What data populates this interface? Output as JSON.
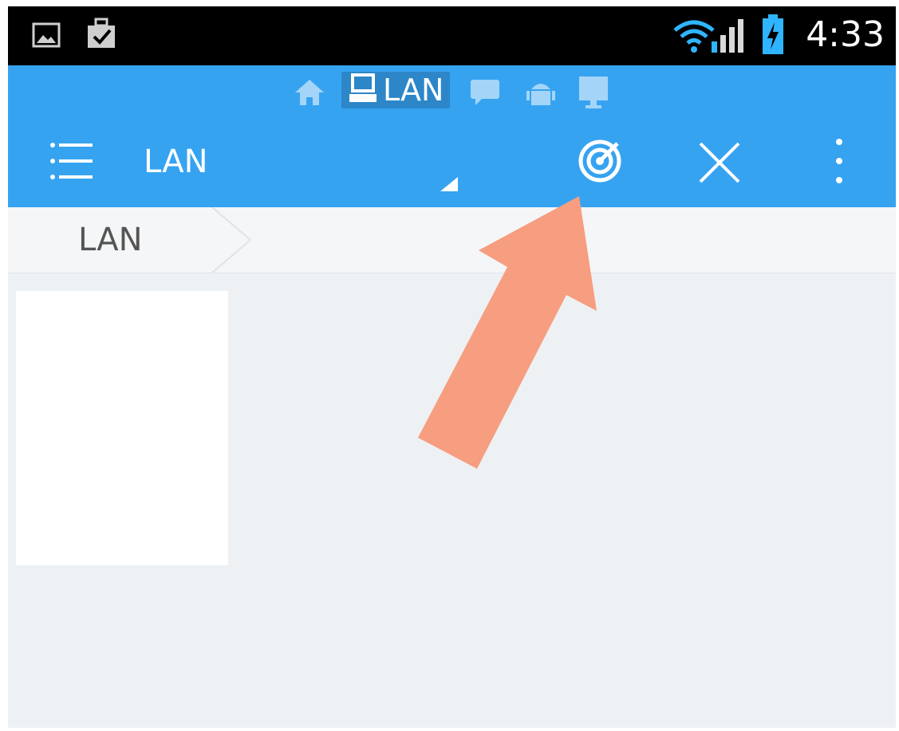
{
  "status_bar": {
    "time": "4:33",
    "left_icons": [
      "image-icon",
      "briefcase-check-icon"
    ],
    "right_icons": [
      "wifi-icon",
      "signal-icon",
      "battery-charging-icon"
    ]
  },
  "window_switcher": {
    "icons": [
      "home-icon",
      "lan-computer-icon",
      "chat-icon",
      "android-icon",
      "cast-icon"
    ],
    "active_label": "LAN"
  },
  "toolbar": {
    "title": "LAN",
    "actions": [
      "menu-icon",
      "scan-radar-icon",
      "close-icon",
      "more-vert-icon"
    ]
  },
  "breadcrumb": {
    "items": [
      "LAN"
    ]
  },
  "colors": {
    "accent": "#36a3f1",
    "arrow": "#f79d80",
    "background": "#eef1f3"
  }
}
